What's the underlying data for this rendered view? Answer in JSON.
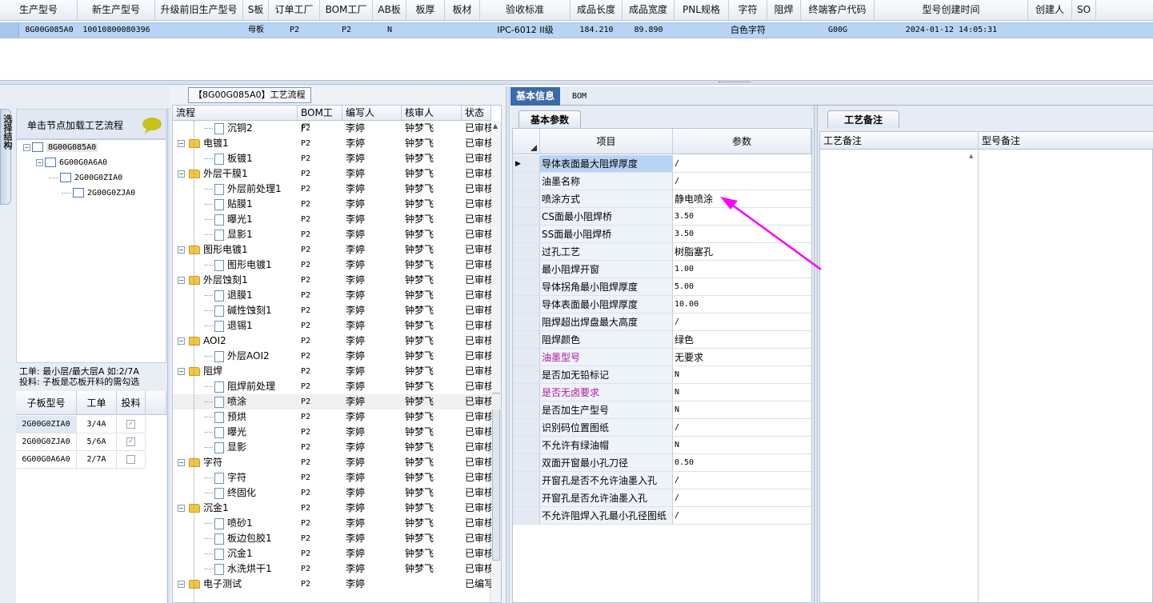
{
  "top_grid": {
    "headers": [
      "生产型号",
      "新生产型号",
      "升级前旧生产型号",
      "S板",
      "订单工厂",
      "BOM工厂",
      "AB板",
      "板厚",
      "板材",
      "验收标准",
      "成品长度",
      "成品宽度",
      "PNL规格",
      "字符",
      "阻焊",
      "终端客户代码",
      "型号创建时间",
      "创建人",
      "SO"
    ],
    "row": [
      "8G00G085A0",
      "10010800080396",
      "",
      "母板",
      "P2",
      "P2",
      "N",
      "",
      "",
      "IPC-6012 II级",
      "184.210",
      "89.890",
      "",
      "白色字符",
      "",
      "G00G",
      "2024-01-12 14:05:31",
      "",
      ""
    ]
  },
  "left_panel": {
    "side_tab": "选择结构",
    "hint": "单击节点加载工艺流程",
    "tree": [
      {
        "label": "8G00G085A0",
        "expander": "−"
      },
      {
        "label": "6G00G0A6A0",
        "expander": "−"
      },
      {
        "label": "2G00G0ZIA0",
        "expander": ""
      },
      {
        "label": "2G00G0ZJA0",
        "expander": ""
      }
    ],
    "info_line1": "工单: 最小层/最大层A 如:2/7A",
    "info_line2": "投料: 子板是芯板开料的需勾选",
    "sub_headers": [
      "子板型号",
      "工单",
      "投料"
    ],
    "sub_rows": [
      {
        "model": "2G00G0ZIA0",
        "order": "3/4A",
        "feed": "✓"
      },
      {
        "model": "2G00G0ZJA0",
        "order": "5/6A",
        "feed": "✓"
      },
      {
        "model": "6G00G0A6A0",
        "order": "2/7A",
        "feed": ""
      }
    ]
  },
  "process": {
    "title": "【8G00G085A0】工艺流程",
    "headers": [
      "流程",
      "BOM工厂",
      "编写人",
      "核审人",
      "状态"
    ],
    "rows": [
      {
        "type": "doc",
        "name": "沉铜2",
        "bom": "P2",
        "writer": "李婷",
        "reviewer": "钟梦飞",
        "status": "已审核"
      },
      {
        "type": "folder",
        "name": "电镀1",
        "bom": "P2",
        "writer": "李婷",
        "reviewer": "钟梦飞",
        "status": "已审核"
      },
      {
        "type": "doc",
        "name": "板镀1",
        "bom": "P2",
        "writer": "李婷",
        "reviewer": "钟梦飞",
        "status": "已审核"
      },
      {
        "type": "folder",
        "name": "外层干膜1",
        "bom": "P2",
        "writer": "李婷",
        "reviewer": "钟梦飞",
        "status": "已审核"
      },
      {
        "type": "doc",
        "name": "外层前处理1",
        "bom": "P2",
        "writer": "李婷",
        "reviewer": "钟梦飞",
        "status": "已审核"
      },
      {
        "type": "doc",
        "name": "贴膜1",
        "bom": "P2",
        "writer": "李婷",
        "reviewer": "钟梦飞",
        "status": "已审核"
      },
      {
        "type": "doc",
        "name": "曝光1",
        "bom": "P2",
        "writer": "李婷",
        "reviewer": "钟梦飞",
        "status": "已审核"
      },
      {
        "type": "doc",
        "name": "显影1",
        "bom": "P2",
        "writer": "李婷",
        "reviewer": "钟梦飞",
        "status": "已审核"
      },
      {
        "type": "folder",
        "name": "图形电镀1",
        "bom": "P2",
        "writer": "李婷",
        "reviewer": "钟梦飞",
        "status": "已审核"
      },
      {
        "type": "doc",
        "name": "图形电镀1",
        "bom": "P2",
        "writer": "李婷",
        "reviewer": "钟梦飞",
        "status": "已审核"
      },
      {
        "type": "folder",
        "name": "外层蚀刻1",
        "bom": "P2",
        "writer": "李婷",
        "reviewer": "钟梦飞",
        "status": "已审核"
      },
      {
        "type": "doc",
        "name": "退膜1",
        "bom": "P2",
        "writer": "李婷",
        "reviewer": "钟梦飞",
        "status": "已审核"
      },
      {
        "type": "doc",
        "name": "碱性蚀刻1",
        "bom": "P2",
        "writer": "李婷",
        "reviewer": "钟梦飞",
        "status": "已审核"
      },
      {
        "type": "doc",
        "name": "退锡1",
        "bom": "P2",
        "writer": "李婷",
        "reviewer": "钟梦飞",
        "status": "已审核"
      },
      {
        "type": "folder",
        "name": "AOI2",
        "bom": "P2",
        "writer": "李婷",
        "reviewer": "钟梦飞",
        "status": "已审核"
      },
      {
        "type": "doc",
        "name": "外层AOI2",
        "bom": "P2",
        "writer": "李婷",
        "reviewer": "钟梦飞",
        "status": "已审核"
      },
      {
        "type": "folder",
        "name": "阻焊",
        "bom": "P2",
        "writer": "李婷",
        "reviewer": "钟梦飞",
        "status": "已审核"
      },
      {
        "type": "doc",
        "name": "阻焊前处理",
        "bom": "P2",
        "writer": "李婷",
        "reviewer": "钟梦飞",
        "status": "已审核"
      },
      {
        "type": "doc",
        "name": "喷涂",
        "bom": "P2",
        "writer": "李婷",
        "reviewer": "钟梦飞",
        "status": "已审核",
        "selected": true
      },
      {
        "type": "doc",
        "name": "预烘",
        "bom": "P2",
        "writer": "李婷",
        "reviewer": "钟梦飞",
        "status": "已审核"
      },
      {
        "type": "doc",
        "name": "曝光",
        "bom": "P2",
        "writer": "李婷",
        "reviewer": "钟梦飞",
        "status": "已审核"
      },
      {
        "type": "doc",
        "name": "显影",
        "bom": "P2",
        "writer": "李婷",
        "reviewer": "钟梦飞",
        "status": "已审核"
      },
      {
        "type": "folder",
        "name": "字符",
        "bom": "P2",
        "writer": "李婷",
        "reviewer": "钟梦飞",
        "status": "已审核"
      },
      {
        "type": "doc",
        "name": "字符",
        "bom": "P2",
        "writer": "李婷",
        "reviewer": "钟梦飞",
        "status": "已审核"
      },
      {
        "type": "doc",
        "name": "终固化",
        "bom": "P2",
        "writer": "李婷",
        "reviewer": "钟梦飞",
        "status": "已审核"
      },
      {
        "type": "folder",
        "name": "沉金1",
        "bom": "P2",
        "writer": "李婷",
        "reviewer": "钟梦飞",
        "status": "已审核"
      },
      {
        "type": "doc",
        "name": "喷砂1",
        "bom": "P2",
        "writer": "李婷",
        "reviewer": "钟梦飞",
        "status": "已审核"
      },
      {
        "type": "doc",
        "name": "板边包胶1",
        "bom": "P2",
        "writer": "李婷",
        "reviewer": "钟梦飞",
        "status": "已审核"
      },
      {
        "type": "doc",
        "name": "沉金1",
        "bom": "P2",
        "writer": "李婷",
        "reviewer": "钟梦飞",
        "status": "已审核"
      },
      {
        "type": "doc",
        "name": "水洗烘干1",
        "bom": "P2",
        "writer": "李婷",
        "reviewer": "钟梦飞",
        "status": "已审核"
      },
      {
        "type": "folder",
        "name": "电子测试",
        "bom": "P2",
        "writer": "李婷",
        "reviewer": "",
        "status": "已编写"
      }
    ]
  },
  "info": {
    "tabs": [
      "基本信息",
      "BOM"
    ],
    "subtab": "基本参数",
    "headers": [
      "项目",
      "参数"
    ],
    "rows": [
      {
        "item": "导体表面最大阻焊厚度",
        "value": "/",
        "pink": false,
        "current": true
      },
      {
        "item": "油墨名称",
        "value": "/",
        "pink": false
      },
      {
        "item": "喷涂方式",
        "value": "静电喷涂",
        "pink": false
      },
      {
        "item": "CS面最小阻焊桥",
        "value": "3.50",
        "pink": false
      },
      {
        "item": "SS面最小阻焊桥",
        "value": "3.50",
        "pink": false
      },
      {
        "item": "过孔工艺",
        "value": "树脂塞孔",
        "pink": false
      },
      {
        "item": "最小阻焊开窗",
        "value": "1.00",
        "pink": false
      },
      {
        "item": "导体拐角最小阻焊厚度",
        "value": "5.00",
        "pink": false
      },
      {
        "item": "导体表面最小阻焊厚度",
        "value": "10.00",
        "pink": false
      },
      {
        "item": "阻焊超出焊盘最大高度",
        "value": "/",
        "pink": false
      },
      {
        "item": "阻焊颜色",
        "value": "绿色",
        "pink": false
      },
      {
        "item": "油墨型号",
        "value": "无要求",
        "pink": true
      },
      {
        "item": "是否加无铅标记",
        "value": "N",
        "pink": false
      },
      {
        "item": "是否无卤要求",
        "value": "N",
        "pink": true
      },
      {
        "item": "是否加生产型号",
        "value": "N",
        "pink": false
      },
      {
        "item": "识别码位置图纸",
        "value": "/",
        "pink": false
      },
      {
        "item": "不允许有绿油帽",
        "value": "N",
        "pink": false
      },
      {
        "item": "双面开窗最小孔刀径",
        "value": "0.50",
        "pink": false
      },
      {
        "item": "开窗孔是否不允许油墨入孔",
        "value": "/",
        "pink": false
      },
      {
        "item": "开窗孔是否允许油墨入孔",
        "value": "/",
        "pink": false
      },
      {
        "item": "不允许阻焊入孔最小孔径图纸",
        "value": "/",
        "pink": false
      }
    ]
  },
  "remarks": {
    "tab": "工艺备注",
    "headers": [
      "工艺备注",
      "型号备注"
    ]
  },
  "colors": {
    "accent": "#3b6aa8",
    "selection": "#b8d4f4",
    "annotation": "#ff00ff",
    "pink_label": "#b0199a"
  }
}
